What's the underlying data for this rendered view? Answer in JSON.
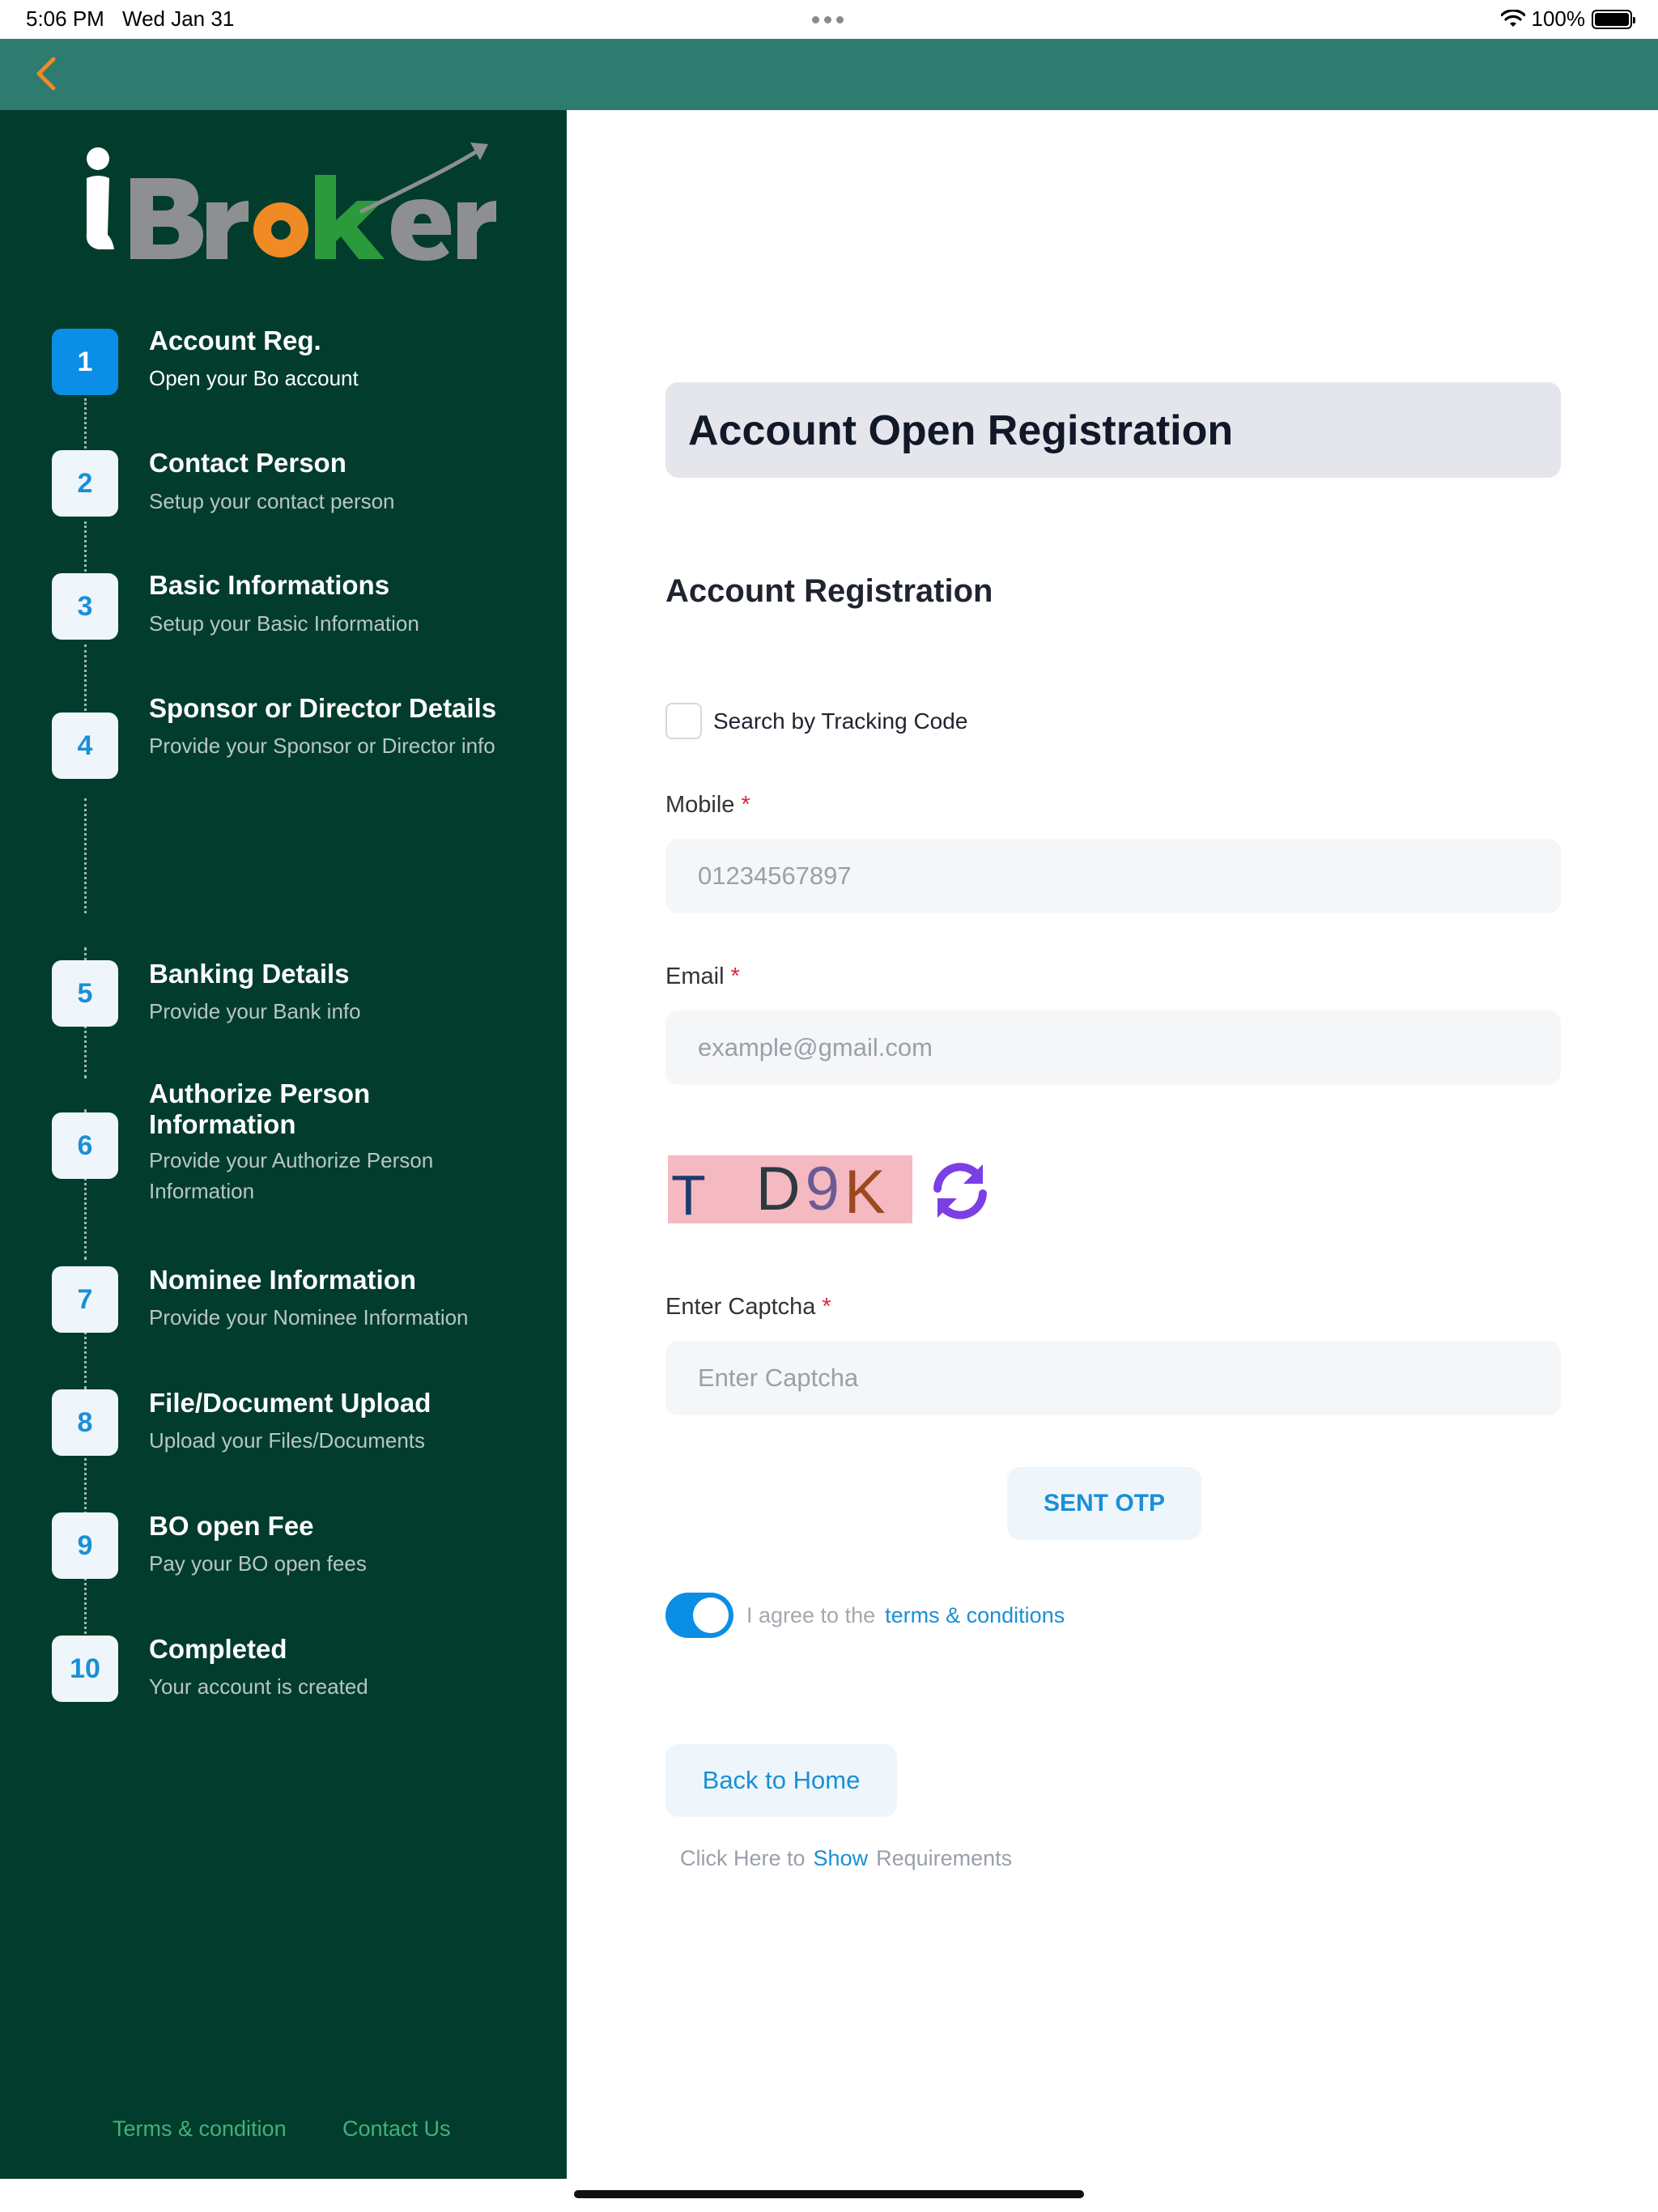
{
  "status_bar": {
    "time": "5:06 PM",
    "date": "Wed Jan 31",
    "battery": "100%"
  },
  "header": {
    "back_icon": "chevron-left-icon",
    "accent_color": "#f08a24",
    "background_color": "#2e7b70"
  },
  "sidebar": {
    "logo_text": "iBroker",
    "background_color": "#023c2d",
    "steps": [
      {
        "number": "1",
        "title": "Account Reg.",
        "desc": "Open your Bo account",
        "active": true
      },
      {
        "number": "2",
        "title": "Contact Person",
        "desc": "Setup your contact person"
      },
      {
        "number": "3",
        "title": "Basic Informations",
        "desc": "Setup your Basic Information"
      },
      {
        "number": "4",
        "title": "Sponsor or Director Details",
        "desc": "Provide your Sponsor or Director info"
      },
      {
        "number": "5",
        "title": "Banking Details",
        "desc": "Provide your Bank info"
      },
      {
        "number": "6",
        "title": "Authorize Person Information",
        "desc": "Provide your Authorize Person Information"
      },
      {
        "number": "7",
        "title": "Nominee Information",
        "desc": "Provide your Nominee Information"
      },
      {
        "number": "8",
        "title": "File/Document Upload",
        "desc": "Upload your Files/Documents"
      },
      {
        "number": "9",
        "title": "BO open Fee",
        "desc": "Pay your BO open fees"
      },
      {
        "number": "10",
        "title": "Completed",
        "desc": "Your account is created"
      }
    ],
    "footer": {
      "terms": "Terms & condition",
      "contact": "Contact Us"
    }
  },
  "main": {
    "page_title": "Account Open Registration",
    "section_title": "Account Registration",
    "tracking_checkbox_label": "Search by Tracking Code",
    "tracking_checked": false,
    "mobile": {
      "label": "Mobile",
      "required_mark": "*",
      "placeholder": "01234567897"
    },
    "email": {
      "label": "Email",
      "required_mark": "*",
      "placeholder": "example@gmail.com"
    },
    "captcha": {
      "characters": [
        "T",
        "D",
        "9",
        "K"
      ],
      "colors": [
        "#1c3c6e",
        "#2c3a40",
        "#6b5b95",
        "#9a4a1e"
      ],
      "background": "#f4b9c1",
      "refresh_icon": "refresh-icon",
      "refresh_color": "#7b3fe4"
    },
    "captcha_input": {
      "label": "Enter Captcha",
      "required_mark": "*",
      "placeholder": "Enter Captcha"
    },
    "otp_button": "SENT OTP",
    "agreement": {
      "toggle_on": true,
      "text": "I agree to the",
      "link": "terms & conditions"
    },
    "back_home_button": "Back to Home",
    "requirements": {
      "prefix": "Click Here to",
      "link": "Show",
      "suffix": "Requirements"
    }
  }
}
